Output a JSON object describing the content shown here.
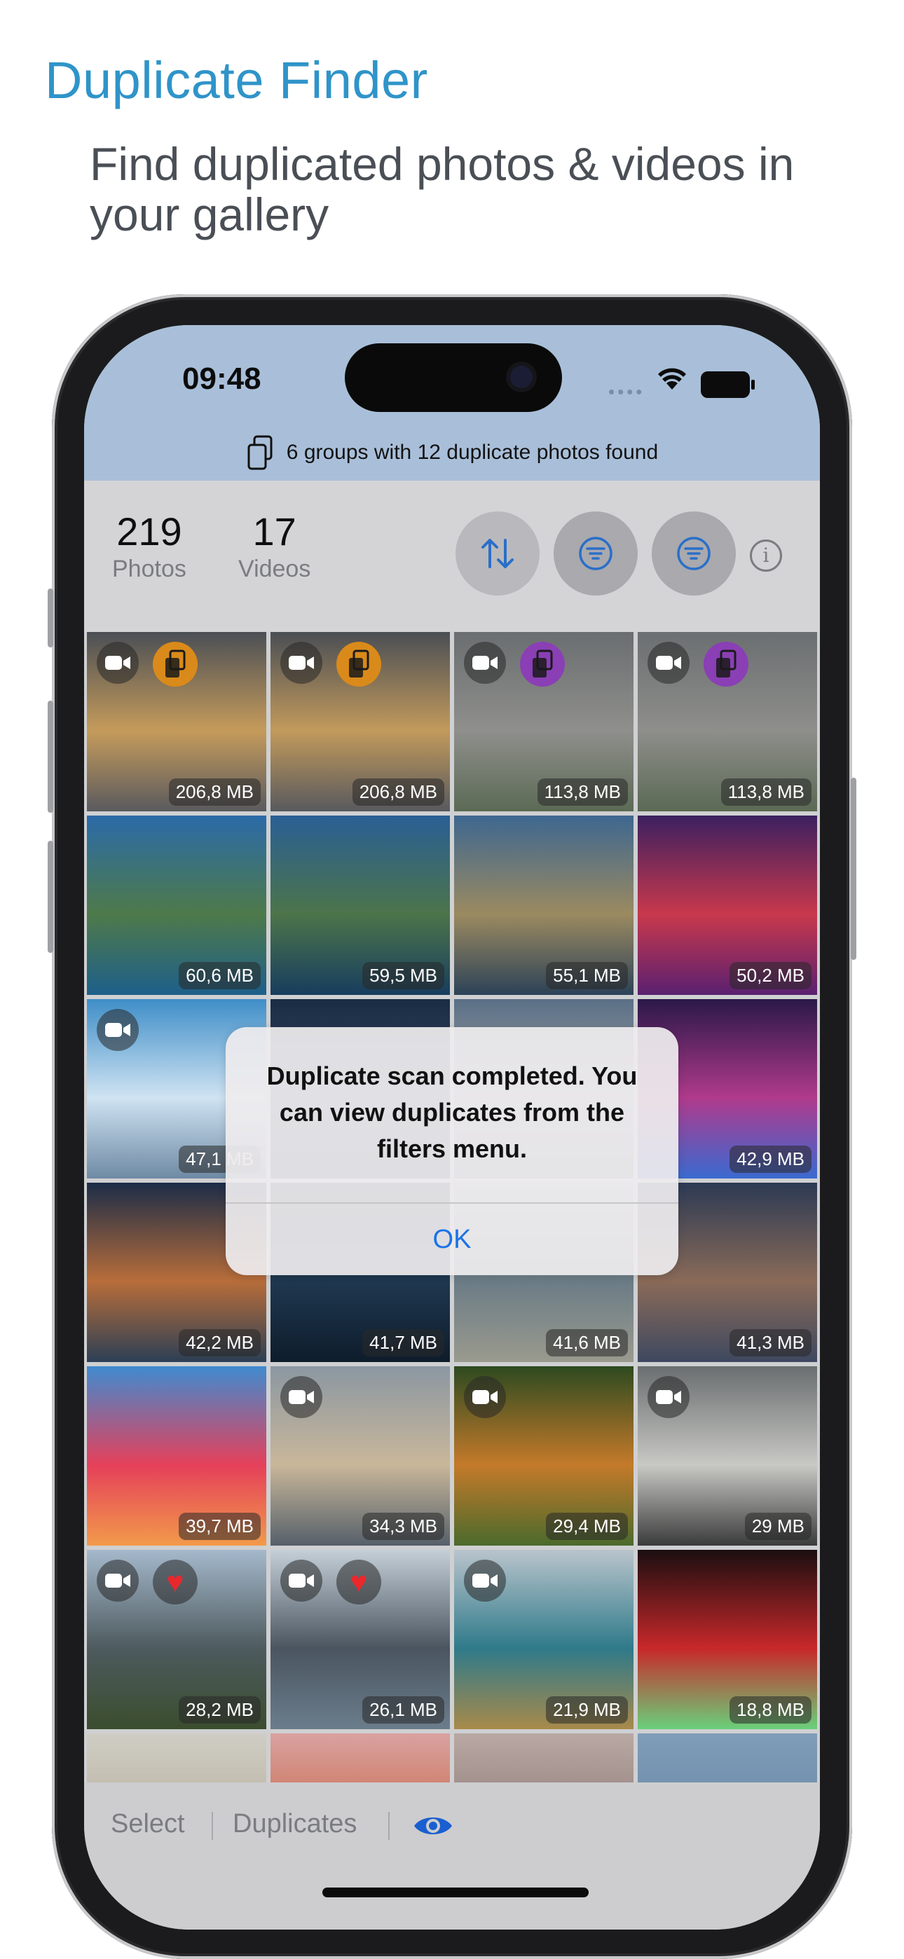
{
  "marketing": {
    "title": "Duplicate Finder",
    "subtitle": "Find duplicated photos & videos in your gallery"
  },
  "status_bar": {
    "time": "09:48",
    "signal": "••••"
  },
  "banner": {
    "icon": "duplicate-docs-icon",
    "text": "6 groups with 12 duplicate photos found"
  },
  "stats": {
    "photos": {
      "value": "219",
      "label": "Photos"
    },
    "videos": {
      "value": "17",
      "label": "Videos"
    }
  },
  "toolbar_buttons": [
    "sort-icon",
    "filter-icon",
    "filter-icon",
    "info-icon"
  ],
  "tiles": [
    {
      "size": "206,8 MB",
      "video": true,
      "dup": "orange",
      "colors": [
        "#4b4f55",
        "#c59b5b",
        "#5a5a5e"
      ]
    },
    {
      "size": "206,8 MB",
      "video": true,
      "dup": "orange",
      "colors": [
        "#4a4e54",
        "#c29a5c",
        "#58595d"
      ]
    },
    {
      "size": "113,8 MB",
      "video": true,
      "dup": "purple",
      "colors": [
        "#6a6e70",
        "#8f8f8c",
        "#5b6a55"
      ]
    },
    {
      "size": "113,8 MB",
      "video": true,
      "dup": "purple",
      "colors": [
        "#6b6f71",
        "#8e8e8b",
        "#5a6954"
      ]
    },
    {
      "size": "60,6 MB",
      "colors": [
        "#2b6aa8",
        "#4e7a4a",
        "#1d5f8a"
      ]
    },
    {
      "size": "59,5 MB",
      "colors": [
        "#2a5f95",
        "#4c744a",
        "#173d5e"
      ]
    },
    {
      "size": "55,1 MB",
      "colors": [
        "#3d6790",
        "#9b8a60",
        "#2c4257"
      ]
    },
    {
      "size": "50,2 MB",
      "colors": [
        "#3b2060",
        "#c8384c",
        "#5a2070"
      ]
    },
    {
      "size": "47,1 MB",
      "video": true,
      "colors": [
        "#3f8ec8",
        "#cfe3f2",
        "#6e8aa4"
      ]
    },
    {
      "size": "",
      "colors": [
        "#1a2c44",
        "#3b4d66",
        "#203247"
      ]
    },
    {
      "size": "",
      "colors": [
        "#5a6f86",
        "#a6a7a6",
        "#6b7b8c"
      ]
    },
    {
      "size": "42,9 MB",
      "colors": [
        "#2a1848",
        "#b03a8c",
        "#3a6ad0"
      ]
    },
    {
      "size": "42,2 MB",
      "colors": [
        "#1c2d48",
        "#b86d3a",
        "#2c3f55"
      ]
    },
    {
      "size": "41,7 MB",
      "colors": [
        "#13283d",
        "#1f3850",
        "#0e1c2b"
      ]
    },
    {
      "size": "41,6 MB",
      "colors": [
        "#a7b3bb",
        "#6b7c86",
        "#9a9a8e"
      ]
    },
    {
      "size": "41,3 MB",
      "colors": [
        "#2c3a54",
        "#8a6a58",
        "#3e4860"
      ]
    },
    {
      "size": "39,7 MB",
      "colors": [
        "#3f8bd0",
        "#e5405a",
        "#f29a4a"
      ]
    },
    {
      "size": "34,3 MB",
      "video": true,
      "colors": [
        "#8b97a2",
        "#c9b79a",
        "#56606a"
      ]
    },
    {
      "size": "29,4 MB",
      "video": true,
      "colors": [
        "#2d4a20",
        "#c47a2a",
        "#4b6a2c"
      ]
    },
    {
      "size": "29 MB",
      "video": true,
      "colors": [
        "#6a6e70",
        "#c8c8c4",
        "#3a3b3b"
      ]
    },
    {
      "size": "28,2 MB",
      "video": true,
      "heart": true,
      "colors": [
        "#a5b9cc",
        "#4d5a5e",
        "#3b4d2e"
      ]
    },
    {
      "size": "26,1 MB",
      "video": true,
      "heart": true,
      "colors": [
        "#c4cfd8",
        "#4a5560",
        "#6b7d8c"
      ]
    },
    {
      "size": "21,9 MB",
      "video": true,
      "colors": [
        "#b9c4cc",
        "#2f7a8a",
        "#a88a4a"
      ]
    },
    {
      "size": "18,8 MB",
      "colors": [
        "#1a0e10",
        "#c8282a",
        "#6ad07a"
      ]
    },
    {
      "size": "",
      "colors": [
        "#cfcdc4",
        "#b8b09e",
        "#a9a290"
      ]
    },
    {
      "size": "",
      "colors": [
        "#d9a2a0",
        "#c86a4a",
        "#e6c0b8"
      ]
    },
    {
      "size": "",
      "colors": [
        "#b9a8a4",
        "#8f7c78",
        "#a59a96"
      ]
    },
    {
      "size": "",
      "colors": [
        "#7f9cb8",
        "#6a89a6",
        "#91aac1"
      ]
    }
  ],
  "alert": {
    "message": "Duplicate scan completed. You can view duplicates from the filters menu.",
    "ok": "OK"
  },
  "bottom_bar": {
    "select": "Select",
    "duplicates": "Duplicates",
    "eye_icon": "eye-icon"
  },
  "colors": {
    "accent": "#1a73e8",
    "status_bg": "#a9bfd9",
    "dup_orange": "#d98a1a",
    "dup_purple": "#8a3fb5"
  }
}
